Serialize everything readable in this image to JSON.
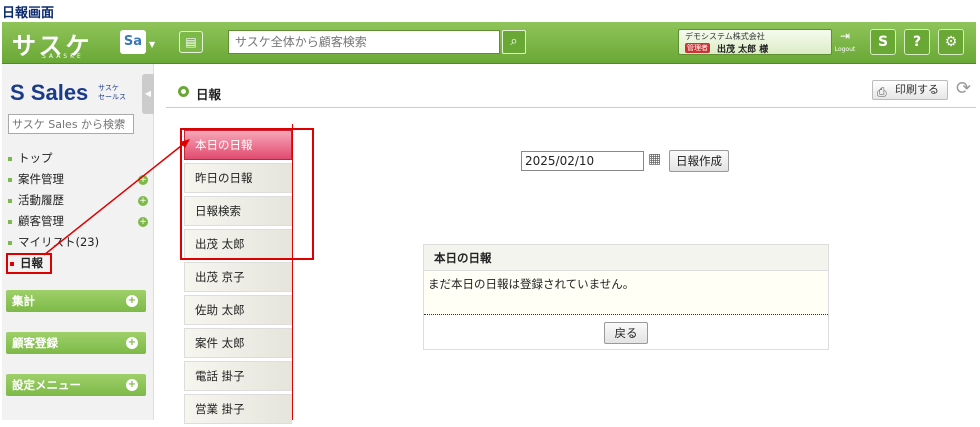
{
  "caption": "日報画面",
  "header": {
    "logo": "サスケ",
    "logo_sub": "SAASKE",
    "app_switch": "Sa",
    "search_placeholder": "サスケ全体から顧客検索",
    "company": "デモシステム株式会社",
    "role_badge": "管理者",
    "user": "出茂 太郎 様",
    "logout": "Logout"
  },
  "sidebar": {
    "product": "Sales",
    "product_sub1": "サスケ",
    "product_sub2": "セールス",
    "search_placeholder": "サスケ Sales から検索",
    "items": [
      {
        "label": "トップ"
      },
      {
        "label": "案件管理"
      },
      {
        "label": "活動履歴"
      },
      {
        "label": "顧客管理"
      },
      {
        "label": "マイリスト(23)"
      },
      {
        "label": "日報"
      }
    ],
    "sections": [
      {
        "label": "集計"
      },
      {
        "label": "顧客登録"
      },
      {
        "label": "設定メニュー"
      }
    ]
  },
  "page": {
    "title": "日報",
    "print_label": "印刷する"
  },
  "tabs": [
    {
      "label": "本日の日報"
    },
    {
      "label": "昨日の日報"
    },
    {
      "label": "日報検索"
    },
    {
      "label": "出茂 太郎"
    },
    {
      "label": "出茂 京子"
    },
    {
      "label": "佐助 太郎"
    },
    {
      "label": "案件 太郎"
    },
    {
      "label": "電話 掛子"
    },
    {
      "label": "営業 掛子"
    }
  ],
  "form": {
    "date": "2025/02/10",
    "create_label": "日報作成"
  },
  "panel": {
    "title": "本日の日報",
    "message": "まだ本日の日報は登録されていません。",
    "back_label": "戻る"
  },
  "colors": {
    "header_green": "#6aa836",
    "active_tab": "#e04b6e",
    "annotation_red": "#dd0000"
  }
}
